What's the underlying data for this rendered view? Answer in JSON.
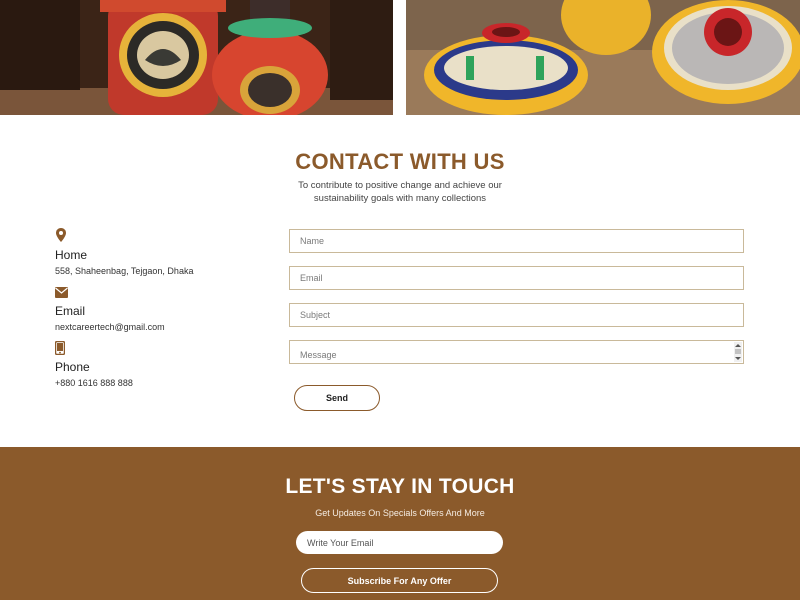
{
  "hero": {
    "left_image_icon": "decorated-vases-image",
    "right_image_icon": "decorated-pots-image"
  },
  "contact": {
    "title": "CONTACT WITH US",
    "subtitle": "To contribute to positive change and achieve our sustainability goals with many collections",
    "info": [
      {
        "icon": "map-pin-icon",
        "label": "Home",
        "value": "558, Shaheenbag, Tejgaon, Dhaka"
      },
      {
        "icon": "envelope-icon",
        "label": "Email",
        "value": "nextcareertech@gmail.com"
      },
      {
        "icon": "phone-icon",
        "label": "Phone",
        "value": "+880 1616 888 888"
      }
    ],
    "form": {
      "name_placeholder": "Name",
      "email_placeholder": "Email",
      "subject_placeholder": "Subject",
      "message_placeholder": "Message",
      "send_label": "Send"
    }
  },
  "footer": {
    "title": "LET'S STAY IN TOUCH",
    "subtitle": "Get Updates On Specials Offers And More",
    "email_placeholder": "Write Your Email",
    "subscribe_label": "Subscribe For Any Offer"
  },
  "colors": {
    "brand_brown": "#8b5a2b",
    "field_border": "#c9b99a",
    "white": "#ffffff"
  }
}
